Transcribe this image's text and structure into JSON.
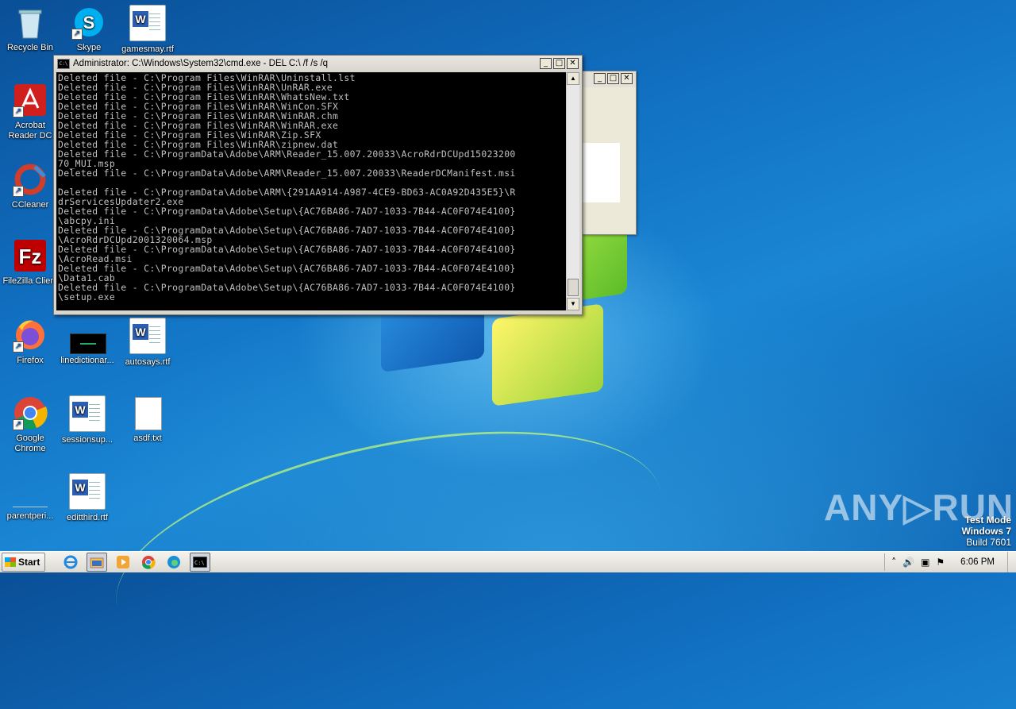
{
  "desktop": {
    "icons": [
      {
        "label": "Recycle Bin",
        "icon": "recycle-bin-icon"
      },
      {
        "label": "Skype",
        "icon": "skype-icon"
      },
      {
        "label": "gamesmay.rtf",
        "icon": "word-document-icon"
      },
      {
        "label": "Acrobat Reader DC",
        "icon": "acrobat-icon"
      },
      {
        "label": "CCleaner",
        "icon": "ccleaner-icon"
      },
      {
        "label": "FileZilla Client",
        "icon": "filezilla-icon"
      },
      {
        "label": "Firefox",
        "icon": "firefox-icon"
      },
      {
        "label": "linedictionar...",
        "icon": "black-image-icon"
      },
      {
        "label": "autosays.rtf",
        "icon": "word-document-icon"
      },
      {
        "label": "Google Chrome",
        "icon": "chrome-icon"
      },
      {
        "label": "sessionsup...",
        "icon": "word-document-icon"
      },
      {
        "label": "asdf.txt",
        "icon": "text-file-icon"
      },
      {
        "label": "parentperi...",
        "icon": "blank-icon"
      },
      {
        "label": "editthird.rtf",
        "icon": "word-document-icon"
      }
    ]
  },
  "cmd_window": {
    "title": "Administrator: C:\\Windows\\System32\\cmd.exe - DEL  C:\\ /f /s /q",
    "minimize": "_",
    "maximize": "□",
    "close": "✕",
    "output": "Deleted file - C:\\Program Files\\WinRAR\\Uninstall.lst\nDeleted file - C:\\Program Files\\WinRAR\\UnRAR.exe\nDeleted file - C:\\Program Files\\WinRAR\\WhatsNew.txt\nDeleted file - C:\\Program Files\\WinRAR\\WinCon.SFX\nDeleted file - C:\\Program Files\\WinRAR\\WinRAR.chm\nDeleted file - C:\\Program Files\\WinRAR\\WinRAR.exe\nDeleted file - C:\\Program Files\\WinRAR\\Zip.SFX\nDeleted file - C:\\Program Files\\WinRAR\\zipnew.dat\nDeleted file - C:\\ProgramData\\Adobe\\ARM\\Reader_15.007.20033\\AcroRdrDCUpd15023200\n70_MUI.msp\nDeleted file - C:\\ProgramData\\Adobe\\ARM\\Reader_15.007.20033\\ReaderDCManifest.msi\n\nDeleted file - C:\\ProgramData\\Adobe\\ARM\\{291AA914-A987-4CE9-BD63-AC0A92D435E5}\\R\ndrServicesUpdater2.exe\nDeleted file - C:\\ProgramData\\Adobe\\Setup\\{AC76BA86-7AD7-1033-7B44-AC0F074E4100}\n\\abcpy.ini\nDeleted file - C:\\ProgramData\\Adobe\\Setup\\{AC76BA86-7AD7-1033-7B44-AC0F074E4100}\n\\AcroRdrDCUpd2001320064.msp\nDeleted file - C:\\ProgramData\\Adobe\\Setup\\{AC76BA86-7AD7-1033-7B44-AC0F074E4100}\n\\AcroRead.msi\nDeleted file - C:\\ProgramData\\Adobe\\Setup\\{AC76BA86-7AD7-1033-7B44-AC0F074E4100}\n\\Data1.cab\nDeleted file - C:\\ProgramData\\Adobe\\Setup\\{AC76BA86-7AD7-1033-7B44-AC0F074E4100}\n\\setup.exe"
  },
  "taskbar": {
    "start_label": "Start",
    "clock": "6:06 PM",
    "pinned": [
      "ie-icon",
      "explorer-icon",
      "media-player-icon",
      "chrome-icon",
      "edge-icon",
      "cmd-icon"
    ]
  },
  "watermark": {
    "brand": "ANY▷RUN",
    "line1": "Test Mode",
    "line2": "Windows 7",
    "line3": "Build 7601"
  }
}
